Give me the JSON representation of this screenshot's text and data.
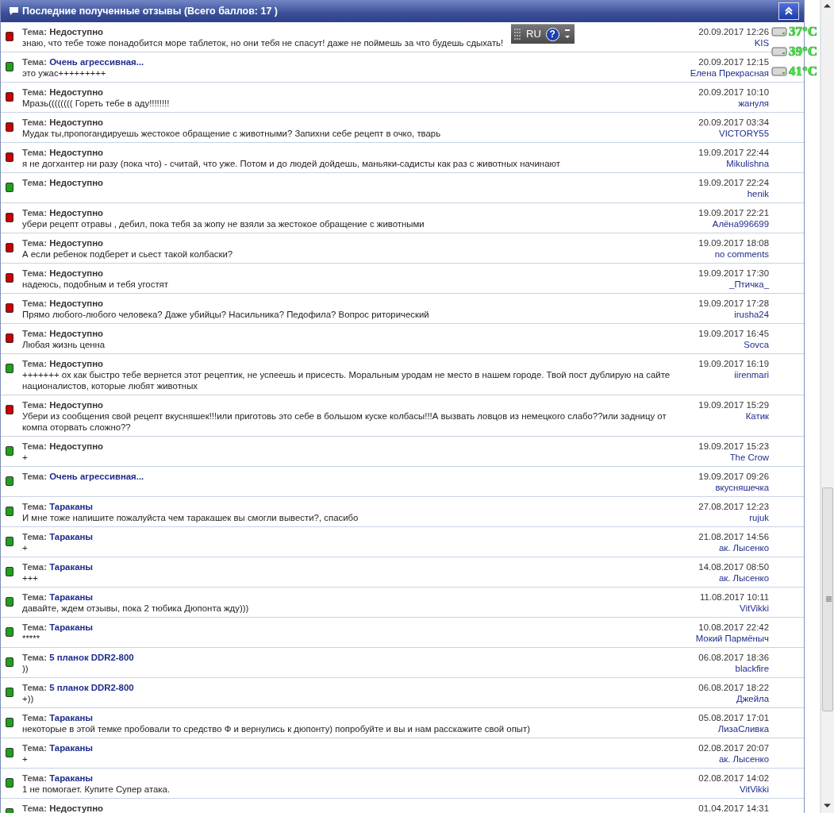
{
  "panel": {
    "title": "Последние полученные отзывы (Всего баллов: 17 )"
  },
  "reviews": [
    {
      "color": "#c80000",
      "topic_label": "Тема:",
      "topic": "Недоступно",
      "topic_linked": false,
      "message": "знаю, что тебе тоже понадобится море таблеток, но они тебя не спасут! даже не поймешь за что будешь сдыхать!",
      "date": "20.09.2017 12:26",
      "author": "KIS"
    },
    {
      "color": "#1fa01f",
      "topic_label": "Тема:",
      "topic": "Очень агрессивная...",
      "topic_linked": true,
      "message": "это ужас+++++++++",
      "date": "20.09.2017 12:15",
      "author": "Елена Прекрасная"
    },
    {
      "color": "#c80000",
      "topic_label": "Тема:",
      "topic": "Недоступно",
      "topic_linked": false,
      "message": "Мразь(((((((( Гореть тебе в аду!!!!!!!!",
      "date": "20.09.2017 10:10",
      "author": "жануля"
    },
    {
      "color": "#c80000",
      "topic_label": "Тема:",
      "topic": "Недоступно",
      "topic_linked": false,
      "message": "Мудак ты,пропогандируешь жестокое обращение с животными? Запихни себе рецепт в очко, тварь",
      "date": "20.09.2017 03:34",
      "author": "VICTORY55"
    },
    {
      "color": "#c80000",
      "topic_label": "Тема:",
      "topic": "Недоступно",
      "topic_linked": false,
      "message": "я не догхантер ни разу (пока что) - считай, что уже. Потом и до людей дойдешь, маньяки-садисты как раз с животных начинают",
      "date": "19.09.2017 22:44",
      "author": "Mikulishna"
    },
    {
      "color": "#1fa01f",
      "topic_label": "Тема:",
      "topic": "Недоступно",
      "topic_linked": false,
      "date": "19.09.2017 22:24",
      "author": "henik"
    },
    {
      "color": "#c80000",
      "topic_label": "Тема:",
      "topic": "Недоступно",
      "topic_linked": false,
      "message": "убери рецепт отравы , дебил, пока тебя за жопу не взяли за жестокое обращение с животными",
      "date": "19.09.2017 22:21",
      "author": "Алёна996699"
    },
    {
      "color": "#c80000",
      "topic_label": "Тема:",
      "topic": "Недоступно",
      "topic_linked": false,
      "message": "А если ребенок подберет и сьест такой колбаски?",
      "date": "19.09.2017 18:08",
      "author": "no comments"
    },
    {
      "color": "#c80000",
      "topic_label": "Тема:",
      "topic": "Недоступно",
      "topic_linked": false,
      "message": "надеюсь, подобным и тебя угостят",
      "date": "19.09.2017 17:30",
      "author": "_Птичка_"
    },
    {
      "color": "#c80000",
      "topic_label": "Тема:",
      "topic": "Недоступно",
      "topic_linked": false,
      "message": "Прямо любого-любого человека? Даже убийцы? Насильника? Педофила? Вопрос риторический",
      "date": "19.09.2017 17:28",
      "author": "irusha24"
    },
    {
      "color": "#c80000",
      "topic_label": "Тема:",
      "topic": "Недоступно",
      "topic_linked": false,
      "message": "Любая жизнь ценна",
      "date": "19.09.2017 16:45",
      "author": "Sovca"
    },
    {
      "color": "#1fa01f",
      "topic_label": "Тема:",
      "topic": "Недоступно",
      "topic_linked": false,
      "message": "+++++++ ох как быстро тебе вернется этот рецептик, не успеешь и присесть. Моральным уродам не место в нашем городе. Твой пост дублирую на сайте националистов, которые любят животных",
      "date": "19.09.2017 16:19",
      "author": "iirenmari"
    },
    {
      "color": "#c80000",
      "topic_label": "Тема:",
      "topic": "Недоступно",
      "topic_linked": false,
      "message": "Убери из сообщения свой рецепт вкусняшек!!!или приготовь это себе в большом куске колбасы!!!А вызвать ловцов из немецкого слабо??или задницу от компа оторвать сложно??",
      "date": "19.09.2017 15:29",
      "author": "Катик"
    },
    {
      "color": "#1fa01f",
      "topic_label": "Тема:",
      "topic": "Недоступно",
      "topic_linked": false,
      "message": "+",
      "date": "19.09.2017 15:23",
      "author": "The Crow"
    },
    {
      "color": "#1fa01f",
      "topic_label": "Тема:",
      "topic": "Очень агрессивная...",
      "topic_linked": true,
      "date": "19.09.2017 09:26",
      "author": "вкусняшечка"
    },
    {
      "color": "#1fa01f",
      "topic_label": "Тема:",
      "topic": "Тараканы",
      "topic_linked": true,
      "message": "И мне тоже напишите пожалуйста чем таракашек вы смогли вывести?, спасибо",
      "date": "27.08.2017 12:23",
      "author": "rujuk"
    },
    {
      "color": "#1fa01f",
      "topic_label": "Тема:",
      "topic": "Тараканы",
      "topic_linked": true,
      "message": "+",
      "date": "21.08.2017 14:56",
      "author": "ак. Лысенко"
    },
    {
      "color": "#1fa01f",
      "topic_label": "Тема:",
      "topic": "Тараканы",
      "topic_linked": true,
      "message": "+++",
      "date": "14.08.2017 08:50",
      "author": "ак. Лысенко"
    },
    {
      "color": "#1fa01f",
      "topic_label": "Тема:",
      "topic": "Тараканы",
      "topic_linked": true,
      "message": "давайте, ждем отзывы, пока 2 тюбика Дюпонта жду)))",
      "date": "11.08.2017 10:11",
      "author": "VitVikki"
    },
    {
      "color": "#1fa01f",
      "topic_label": "Тема:",
      "topic": "Тараканы",
      "topic_linked": true,
      "message": "*****",
      "date": "10.08.2017 22:42",
      "author": "Мокий Пармёныч"
    },
    {
      "color": "#1fa01f",
      "topic_label": "Тема:",
      "topic": "5 планок DDR2-800",
      "topic_linked": true,
      "message": "))",
      "date": "06.08.2017 18:36",
      "author": "blackfire"
    },
    {
      "color": "#1fa01f",
      "topic_label": "Тема:",
      "topic": "5 планок DDR2-800",
      "topic_linked": true,
      "message": "+))",
      "date": "06.08.2017 18:22",
      "author": "Джейла"
    },
    {
      "color": "#1fa01f",
      "topic_label": "Тема:",
      "topic": "Тараканы",
      "topic_linked": true,
      "message": "некоторые в этой темке пробовали то средство Ф и вернулись к дюпонту) попробуйте и вы и нам расскажите свой опыт)",
      "date": "05.08.2017 17:01",
      "author": "ЛизаСливка"
    },
    {
      "color": "#1fa01f",
      "topic_label": "Тема:",
      "topic": "Тараканы",
      "topic_linked": true,
      "message": "+",
      "date": "02.08.2017 20:07",
      "author": "ак. Лысенко"
    },
    {
      "color": "#1fa01f",
      "topic_label": "Тема:",
      "topic": "Тараканы",
      "topic_linked": true,
      "message": "1 не помогает. Купите Супер атака.",
      "date": "02.08.2017 14:02",
      "author": "VitVikki"
    },
    {
      "color": "#1fa01f",
      "topic_label": "Тема:",
      "topic": "Недоступно",
      "topic_linked": false,
      "date": "01.04.2017 14:31"
    }
  ],
  "language_bar": {
    "language": "RU",
    "help": "?"
  },
  "temperatures": [
    {
      "reading": "37°C"
    },
    {
      "reading": "39°C"
    },
    {
      "reading": "41°C"
    }
  ]
}
